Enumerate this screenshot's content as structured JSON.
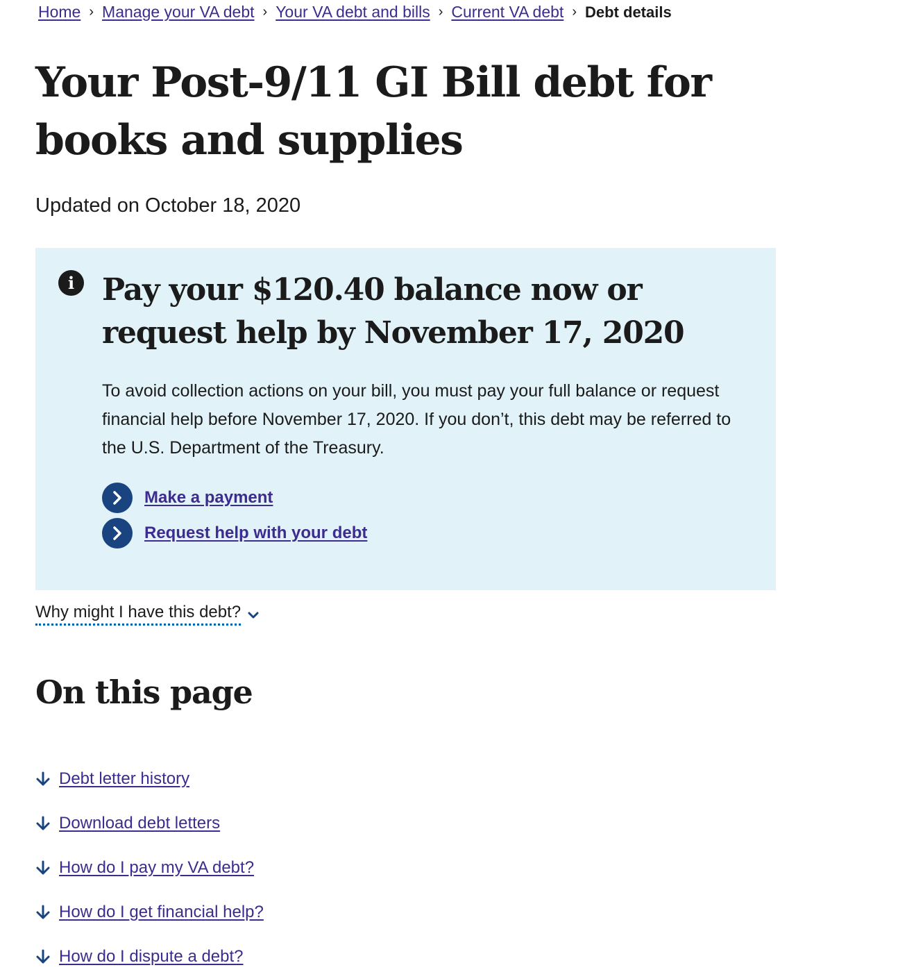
{
  "breadcrumb": {
    "items": [
      "Home",
      "Manage your VA debt",
      "Your VA debt and bills",
      "Current VA debt"
    ],
    "current": "Debt details"
  },
  "page": {
    "title": "Your Post-9/11 GI Bill debt for books and supplies",
    "updated": "Updated on October 18, 2020"
  },
  "alert": {
    "icon": "info-icon",
    "heading": "Pay your $120.40 balance now or request help by November 17, 2020",
    "body": "To avoid collection actions on your bill, you must pay your full balance or request financial help before November 17, 2020. If you don’t, this debt may be referred to the U.S. Department of the Treasury.",
    "actions": [
      "Make a payment",
      "Request help with your debt"
    ]
  },
  "why": {
    "label": "Why might I have this debt?"
  },
  "on_this_page": {
    "heading": "On this page",
    "links": [
      "Debt letter history",
      "Download debt letters",
      "How do I pay my VA debt?",
      "How do I get financial help?",
      "How do I dispute a debt?"
    ]
  },
  "colors": {
    "link": "#3d2b8f",
    "alert_bg": "#e1f3f8",
    "action_circle": "#1a4480",
    "dotted_underline": "#005ea2"
  }
}
